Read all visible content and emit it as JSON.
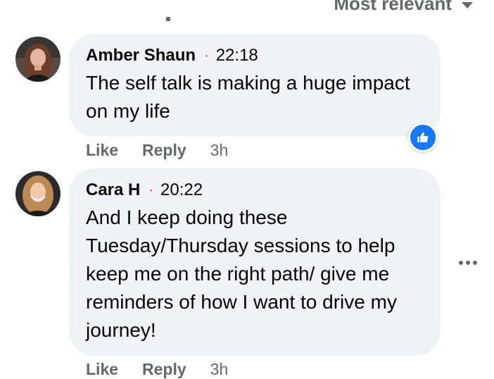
{
  "header": {
    "sort_label": "Most relevant",
    "sort_icon": "caret-down-icon"
  },
  "comments": [
    {
      "author": "Amber Shaun",
      "time": "22:18",
      "text": "The self talk is making a huge impact on my life",
      "actions": {
        "like": "Like",
        "reply": "Reply",
        "ago": "3h"
      },
      "reaction_icon": "thumbs-up-icon",
      "colors": {
        "reaction": "#1877f2"
      }
    },
    {
      "author": "Cara H",
      "time": "20:22",
      "text": "And I keep doing these Tuesday/Thursday sessions to help keep me on the right path/ give me reminders of how I want to drive my journey!",
      "actions": {
        "like": "Like",
        "reply": "Reply",
        "ago": "3h"
      },
      "more_icon": "more-options-icon"
    }
  ],
  "colors": {
    "bubble": "#f0f2f5",
    "secondary_text": "#65676b",
    "dot": "#e0245e"
  }
}
